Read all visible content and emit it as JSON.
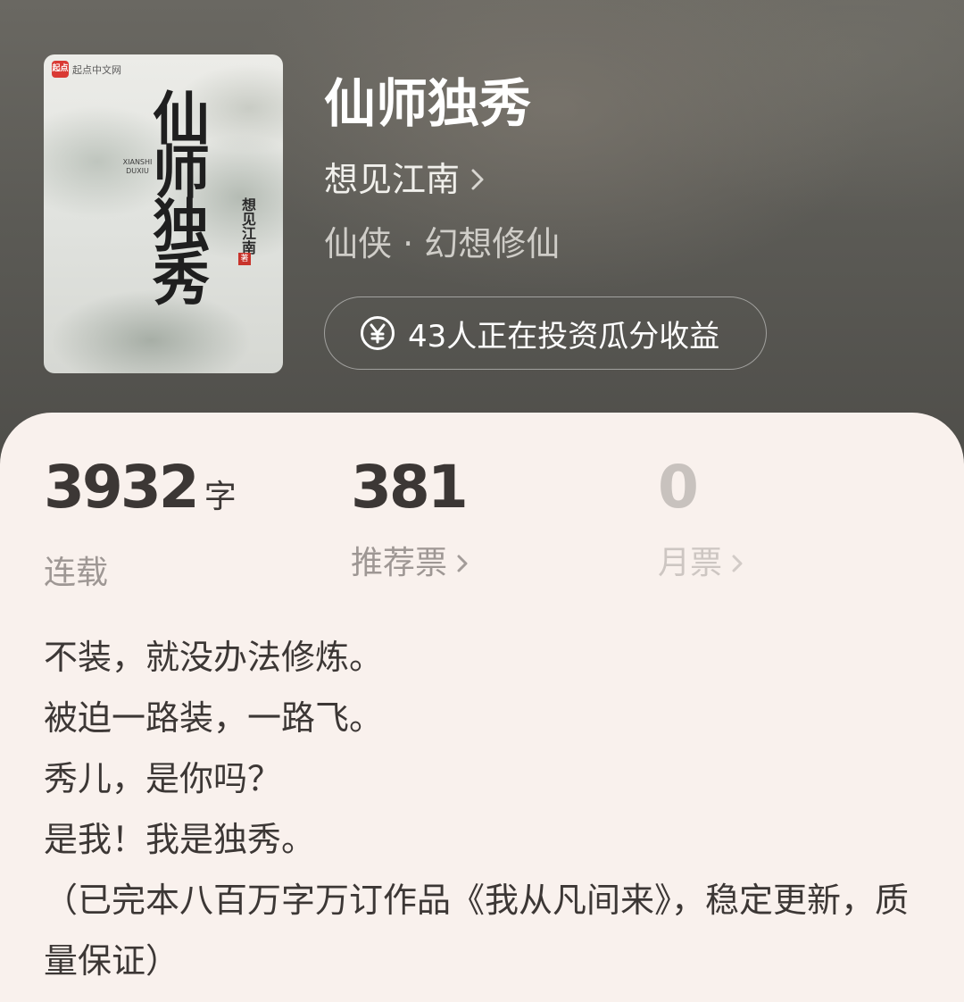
{
  "cover": {
    "logo_badge": "起点",
    "logo_text": "起点中文网",
    "title_art": "仙师独秀",
    "pinyin_line1": "XIANSHI",
    "pinyin_line2": "DUXIU",
    "author_art": "想见江南",
    "seal": "著"
  },
  "book": {
    "title": "仙师独秀",
    "author": "想见江南",
    "genre": "仙侠 · 幻想修仙",
    "invest_text": "43人正在投资瓜分收益"
  },
  "stats": [
    {
      "value": "3932",
      "unit": "字",
      "label": "连载"
    },
    {
      "value": "381",
      "label": "推荐票"
    },
    {
      "value": "0",
      "label": "月票"
    }
  ],
  "description": [
    "不装，就没办法修炼。",
    "被迫一路装，一路飞。",
    "秀儿，是你吗？",
    "是我！我是独秀。",
    "（已完本八百万字万订作品《我从凡间来》，稳定更新，质量保证）"
  ],
  "colors": {
    "sheet_bg": "#f9f1ed",
    "text_dark": "#3c3735",
    "text_muted": "#9e9794"
  }
}
